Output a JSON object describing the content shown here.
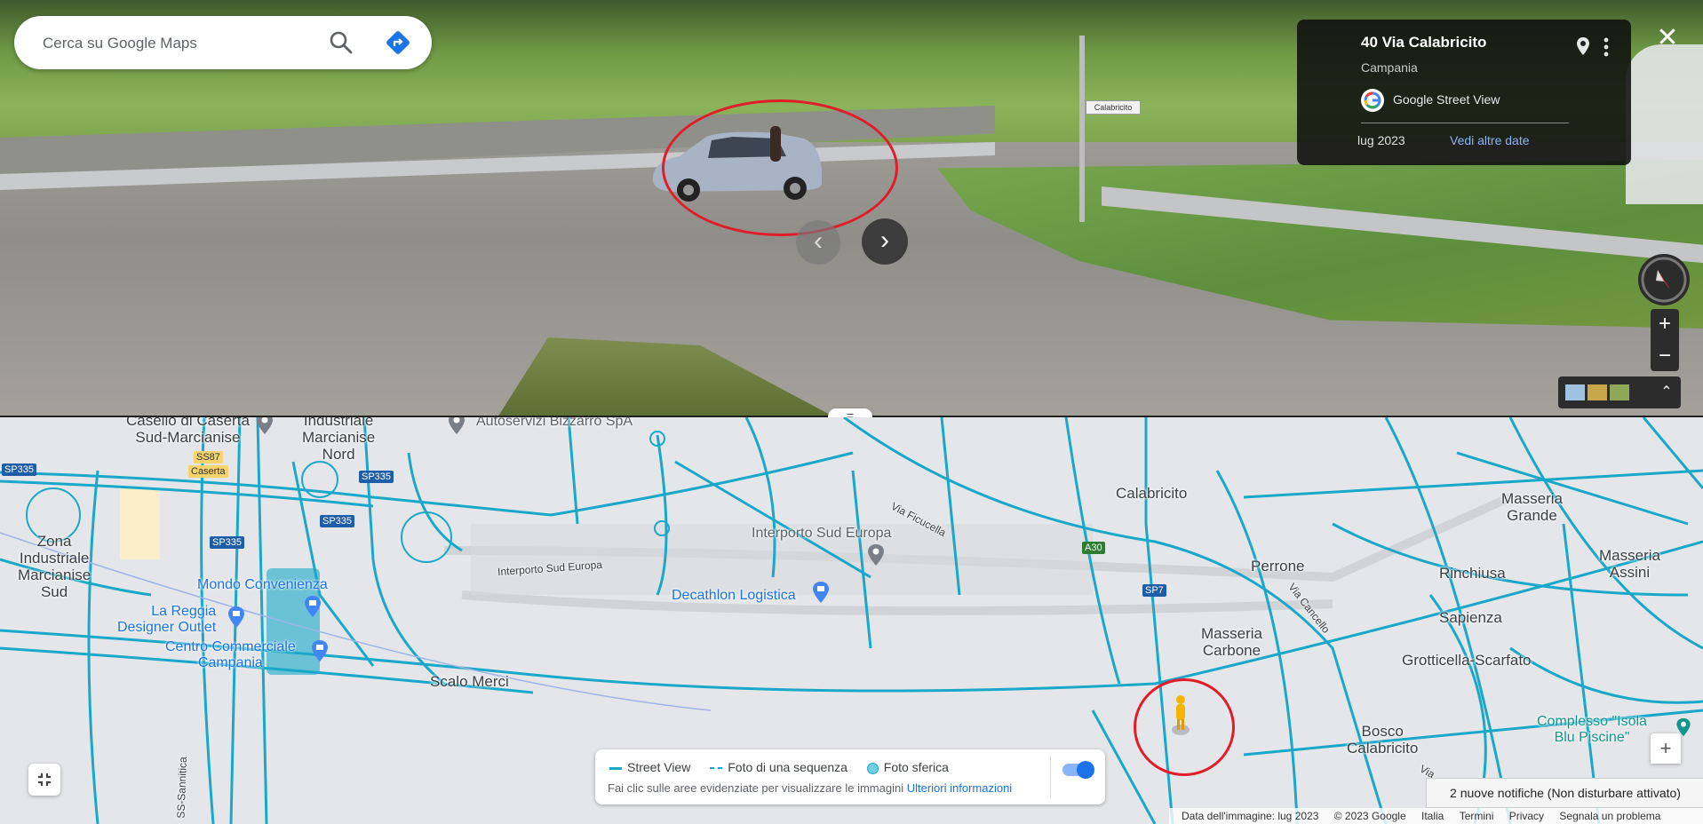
{
  "search": {
    "placeholder": "Cerca su Google Maps"
  },
  "info_card": {
    "title": "40 Via Calabricito",
    "region": "Campania",
    "source": "Google Street View",
    "date": "lug 2023",
    "more_dates": "Vedi altre date"
  },
  "street_view": {
    "sign_text": "Calabricito",
    "prev_arrow": "‹",
    "next_arrow": "›",
    "zoom_in": "+",
    "zoom_out": "−",
    "close": "✕",
    "divider": "="
  },
  "map": {
    "places": [
      {
        "text": "Caselio di Caserta\nSud-Marcianise"
      },
      {
        "text": "Industriale\nMarcianise\nNord"
      },
      {
        "text": "Zona\nIndustriale\nMarcianise\nSud"
      },
      {
        "text": "Scalo Merci"
      },
      {
        "text": "Calabricito"
      },
      {
        "text": "Perrone"
      },
      {
        "text": "Masseria\nCarbone"
      },
      {
        "text": "Masseria\nGrande"
      },
      {
        "text": "Rinchiusa"
      },
      {
        "text": "Masseria\nAssini"
      },
      {
        "text": "Sapienza"
      },
      {
        "text": "Grotticella-Scarfato"
      },
      {
        "text": "Bosco\nCalabricito"
      }
    ],
    "pois": {
      "autoservizi": "Autoservizi Bizzarro SpA",
      "interporto": "Interporto Sud Europa",
      "decathlon": "Decathlon Logistica",
      "mondo": "Mondo Convenienza",
      "reggia": "La Reggia\nDesigner Outlet",
      "centro": "Centro Commerciale\nCampania",
      "complesso": "Complesso \"Isola\nBlu Piscine\""
    },
    "roads": {
      "interporto_sud_europa": "Interporto Sud Europa",
      "via_ficucella": "Via Ficucella",
      "via_cancello": "Via Cancello",
      "ss_sannitica": "SS-Sannitica",
      "via": "Via"
    },
    "shields": {
      "sp335_a": "SP335",
      "sp335_b": "SP335",
      "sp335_c": "SP335",
      "sp335_d": "SP335",
      "ss87": "SS87",
      "caserta": "Caserta",
      "a30": "A30",
      "sp7": "SP7"
    }
  },
  "legend": {
    "street_view": "Street View",
    "sequence": "Foto di una sequenza",
    "spherical": "Foto sferica",
    "hint": "Fai clic sulle aree evidenziate per visualizzare le immagini",
    "more_info": "Ulteriori informazioni"
  },
  "map_controls": {
    "zoom_in": "+"
  },
  "notification": "2 nuove notifiche (Non disturbare attivato)",
  "footer": {
    "image_date": "Data dell'immagine: lug 2023",
    "copyright": "© 2023 Google",
    "italia": "Italia",
    "termini": "Termini",
    "privacy": "Privacy",
    "report": "Segnala un problema"
  },
  "colors": {
    "street_view_line": "#19a8c9",
    "highlight_ring": "#e11d2a",
    "link_blue": "#1a73e8"
  }
}
